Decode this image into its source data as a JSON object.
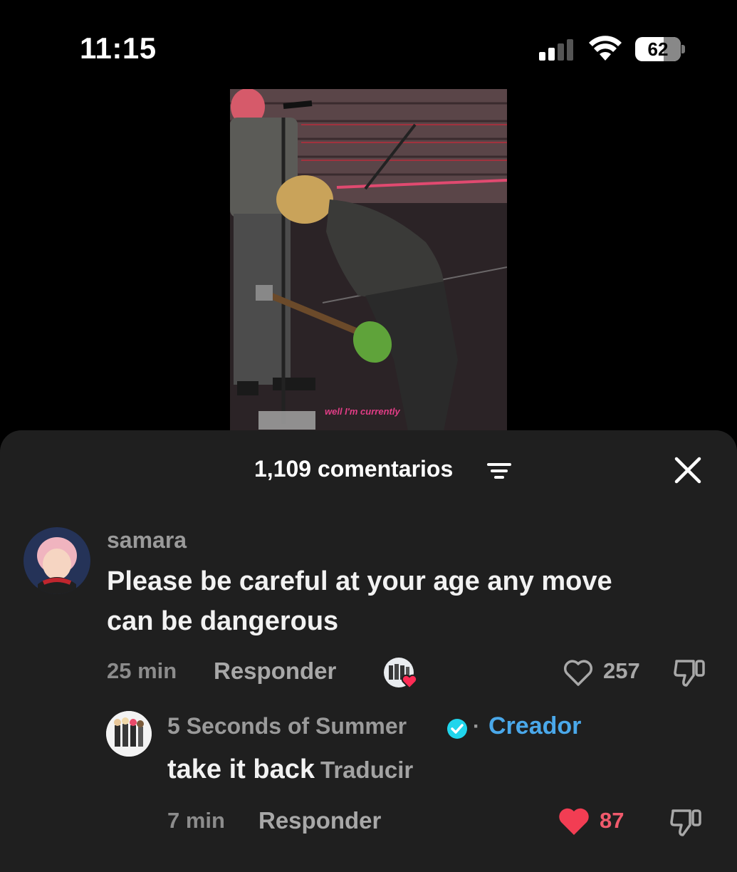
{
  "status_bar": {
    "time": "11:15",
    "battery": "62",
    "battery_level": 0.62,
    "signal_bars_active": 2,
    "signal_bars_total": 4
  },
  "video": {
    "caption": "well I'm currently"
  },
  "comments_sheet": {
    "title": "1,109 comentarios",
    "filter_icon": "filter-lines-icon",
    "close_icon": "close-x-icon",
    "comments": [
      {
        "username": "samara",
        "text_line1": "Please be careful at your age any move",
        "text_line2": "can be dangerous",
        "time": "25 min",
        "reply_label": "Responder",
        "likes": "257",
        "liked": false,
        "creator_liked": true
      }
    ],
    "reply": {
      "username": "5 Seconds of Summer",
      "separator": "·",
      "creator_label": "Creador",
      "text": "take it back",
      "translate_label": "Traducir",
      "time": "7 min",
      "reply_label": "Responder",
      "likes": "87",
      "liked": true
    }
  },
  "colors": {
    "sheet_bg": "#1f1f1f",
    "accent_blue": "#4aa8ea",
    "like_red": "#fe2c55"
  }
}
